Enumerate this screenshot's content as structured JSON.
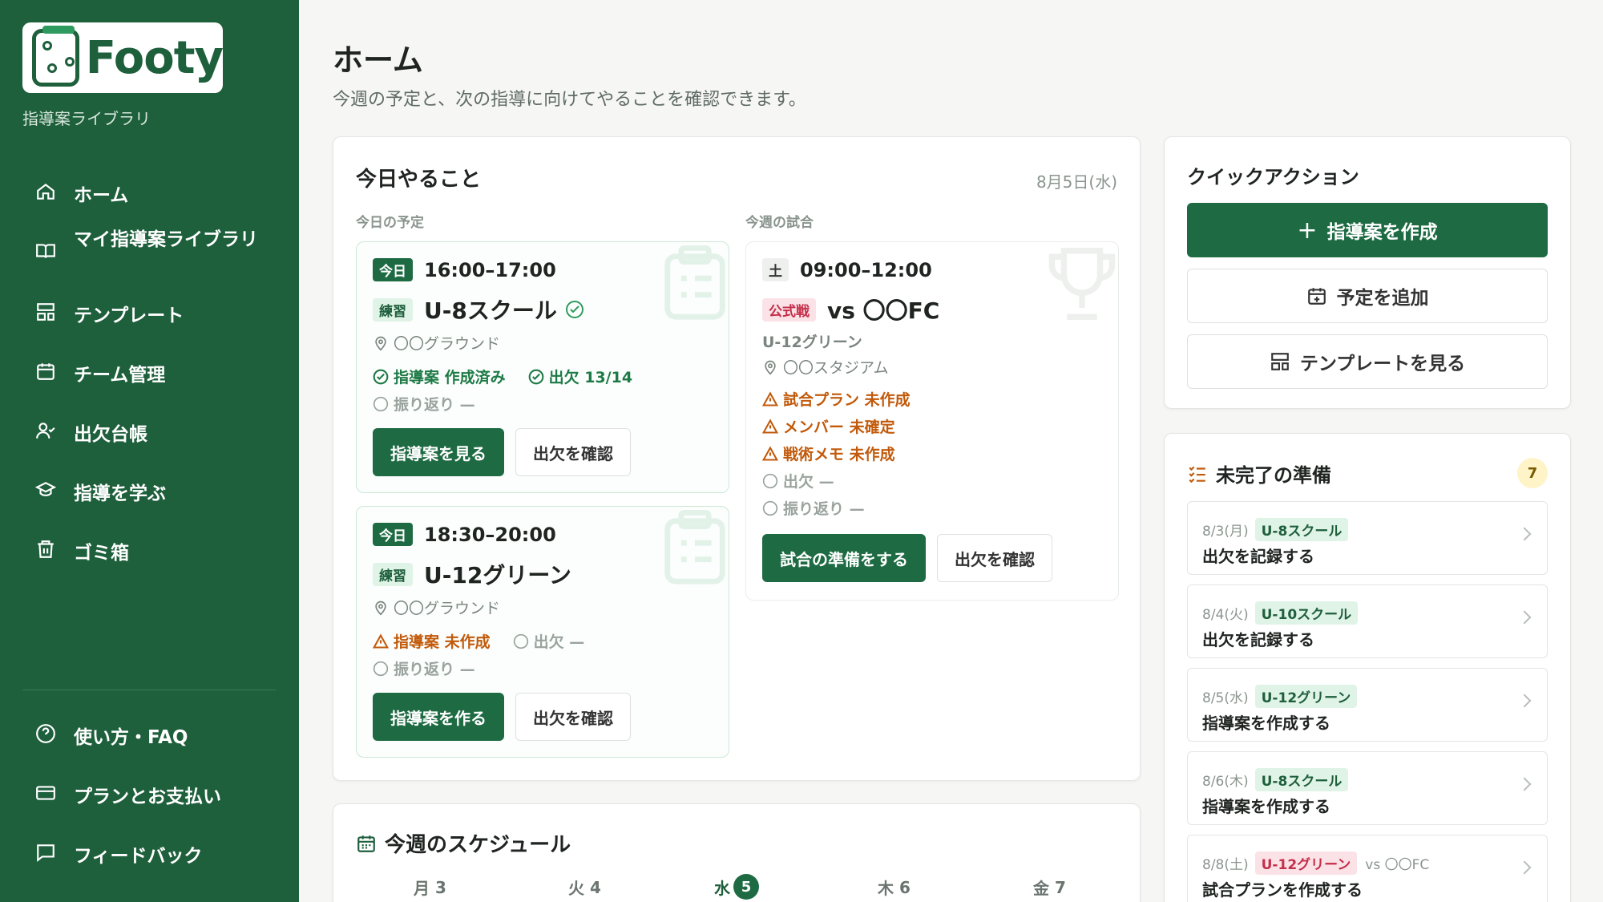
{
  "sidebar": {
    "logo_text": "Footy",
    "subtitle": "指導案ライブラリ",
    "nav": [
      {
        "label": "ホーム",
        "icon": "home-icon"
      },
      {
        "label": "マイ指導案ライブラリ",
        "icon": "book-icon"
      },
      {
        "label": "テンプレート",
        "icon": "template-icon"
      },
      {
        "label": "チーム管理",
        "icon": "calendar-icon"
      },
      {
        "label": "出欠台帳",
        "icon": "user-check-icon"
      },
      {
        "label": "指導を学ぶ",
        "icon": "graduation-cap-icon"
      },
      {
        "label": "ゴミ箱",
        "icon": "trash-icon"
      }
    ],
    "footer_nav": [
      {
        "label": "使い方・FAQ",
        "icon": "help-circle-icon"
      },
      {
        "label": "プランとお支払い",
        "icon": "credit-card-icon"
      },
      {
        "label": "フィードバック",
        "icon": "message-icon"
      }
    ]
  },
  "header": {
    "title": "ホーム",
    "subtitle": "今週の予定と、次の指導に向けてやることを確認できます。"
  },
  "today": {
    "title": "今日やること",
    "date": "8月5日(水)",
    "schedule_label": "今日の予定",
    "match_label": "今週の試合",
    "events": [
      {
        "day_badge": "今日",
        "time": "16:00–17:00",
        "type_badge": "練習",
        "team": "U-8スクール",
        "location": "〇〇グラウンド",
        "status1": "指導案 作成済み",
        "status2": "出欠 13/14",
        "status3": "振り返り —",
        "primary_btn": "指導案を見る",
        "secondary_btn": "出欠を確認"
      },
      {
        "day_badge": "今日",
        "time": "18:30–20:00",
        "type_badge": "練習",
        "team": "U-12グリーン",
        "location": "〇〇グラウンド",
        "status1": "指導案 未作成",
        "status2": "出欠 —",
        "status3": "振り返り —",
        "primary_btn": "指導案を作る",
        "secondary_btn": "出欠を確認"
      }
    ],
    "match": {
      "day_badge": "土",
      "time": "09:00–12:00",
      "type_badge": "公式戦",
      "opponent": "vs 〇〇FC",
      "team": "U-12グリーン",
      "location": "〇〇スタジアム",
      "warn1": "試合プラン 未作成",
      "warn2": "メンバー 未確定",
      "warn3": "戦術メモ 未作成",
      "pending1": "出欠 —",
      "pending2": "振り返り —",
      "primary_btn": "試合の準備をする",
      "secondary_btn": "出欠を確認"
    }
  },
  "quick_actions": {
    "title": "クイックアクション",
    "create": "指導案を作成",
    "add_event": "予定を追加",
    "view_templates": "テンプレートを見る"
  },
  "pending": {
    "title": "未完了の準備",
    "count": "7",
    "items": [
      {
        "date": "8/3(月)",
        "team": "U-8スクール",
        "team_color": "green",
        "extra": "",
        "task": "出欠を記録する"
      },
      {
        "date": "8/4(火)",
        "team": "U-10スクール",
        "team_color": "green",
        "extra": "",
        "task": "出欠を記録する"
      },
      {
        "date": "8/5(水)",
        "team": "U-12グリーン",
        "team_color": "green",
        "extra": "",
        "task": "指導案を作成する"
      },
      {
        "date": "8/6(木)",
        "team": "U-8スクール",
        "team_color": "green",
        "extra": "",
        "task": "指導案を作成する"
      },
      {
        "date": "8/8(土)",
        "team": "U-12グリーン",
        "team_color": "red",
        "extra": "vs 〇〇FC",
        "task": "試合プランを作成する"
      }
    ]
  },
  "week": {
    "title": "今週のスケジュール",
    "days": [
      {
        "label": "月",
        "num": "3"
      },
      {
        "label": "火",
        "num": "4"
      },
      {
        "label": "水",
        "num": "5"
      },
      {
        "label": "木",
        "num": "6"
      },
      {
        "label": "金",
        "num": "7"
      }
    ]
  },
  "colors": {
    "brand": "#1e5f3c",
    "primary_button": "#1e6b43",
    "warning": "#c25a0b",
    "alert_red": "#c42e4a"
  }
}
